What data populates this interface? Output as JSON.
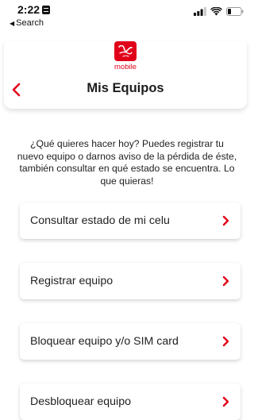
{
  "status_bar": {
    "time": "2:22",
    "back_label": "Search"
  },
  "header": {
    "logo_text": "Virgin",
    "logo_subtext": "mobile",
    "title": "Mis Equipos"
  },
  "intro_text": "¿Qué quieres hacer hoy? Puedes registrar tu nuevo equipo o darnos aviso de la pérdida de éste, también consultar en qué estado se encuentra. Lo que quieras!",
  "options": [
    {
      "label": "Consultar estado de mi celu"
    },
    {
      "label": "Registrar equipo"
    },
    {
      "label": "Bloquear equipo y/o SIM card"
    },
    {
      "label": "Desbloquear equipo"
    }
  ],
  "colors": {
    "brand_red": "#e1001a",
    "text_dark": "#1c1c1c"
  },
  "icons": {
    "back": "chevron-left-icon",
    "option_arrow": "chevron-right-icon",
    "logo": "virgin-mobile-logo"
  }
}
